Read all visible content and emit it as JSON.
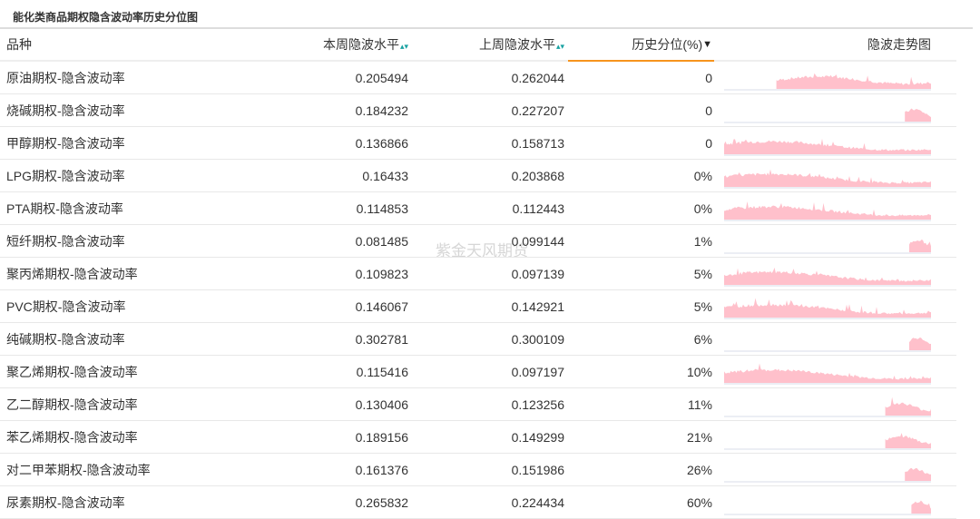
{
  "title": "能化类商品期权隐含波动率历史分位图",
  "watermark": "紫金天风期货",
  "columns": {
    "name": "品种",
    "this_week": "本周隐波水平",
    "last_week": "上周隐波水平",
    "percentile": "历史分位(%)",
    "trend": "隐波走势图"
  },
  "colors": {
    "accent": "#f7941d",
    "sort": "#19a1a1",
    "spark": "#ffc0cb"
  },
  "rows": [
    {
      "name": "原油期权-隐含波动率",
      "this_week": "0.205494",
      "last_week": "0.262044",
      "percentile": "0"
    },
    {
      "name": "烧碱期权-隐含波动率",
      "this_week": "0.184232",
      "last_week": "0.227207",
      "percentile": "0"
    },
    {
      "name": "甲醇期权-隐含波动率",
      "this_week": "0.136866",
      "last_week": "0.158713",
      "percentile": "0"
    },
    {
      "name": "LPG期权-隐含波动率",
      "this_week": "0.16433",
      "last_week": "0.203868",
      "percentile": "0%"
    },
    {
      "name": "PTA期权-隐含波动率",
      "this_week": "0.114853",
      "last_week": "0.112443",
      "percentile": "0%"
    },
    {
      "name": "短纤期权-隐含波动率",
      "this_week": "0.081485",
      "last_week": "0.099144",
      "percentile": "1%"
    },
    {
      "name": "聚丙烯期权-隐含波动率",
      "this_week": "0.109823",
      "last_week": "0.097139",
      "percentile": "5%"
    },
    {
      "name": "PVC期权-隐含波动率",
      "this_week": "0.146067",
      "last_week": "0.142921",
      "percentile": "5%"
    },
    {
      "name": "纯碱期权-隐含波动率",
      "this_week": "0.302781",
      "last_week": "0.300109",
      "percentile": "6%"
    },
    {
      "name": "聚乙烯期权-隐含波动率",
      "this_week": "0.115416",
      "last_week": "0.097197",
      "percentile": "10%"
    },
    {
      "name": "乙二醇期权-隐含波动率",
      "this_week": "0.130406",
      "last_week": "0.123256",
      "percentile": "11%"
    },
    {
      "name": "苯乙烯期权-隐含波动率",
      "this_week": "0.189156",
      "last_week": "0.149299",
      "percentile": "21%"
    },
    {
      "name": "对二甲苯期权-隐含波动率",
      "this_week": "0.161376",
      "last_week": "0.151986",
      "percentile": "26%"
    },
    {
      "name": "尿素期权-隐含波动率",
      "this_week": "0.265832",
      "last_week": "0.224434",
      "percentile": "60%"
    }
  ]
}
